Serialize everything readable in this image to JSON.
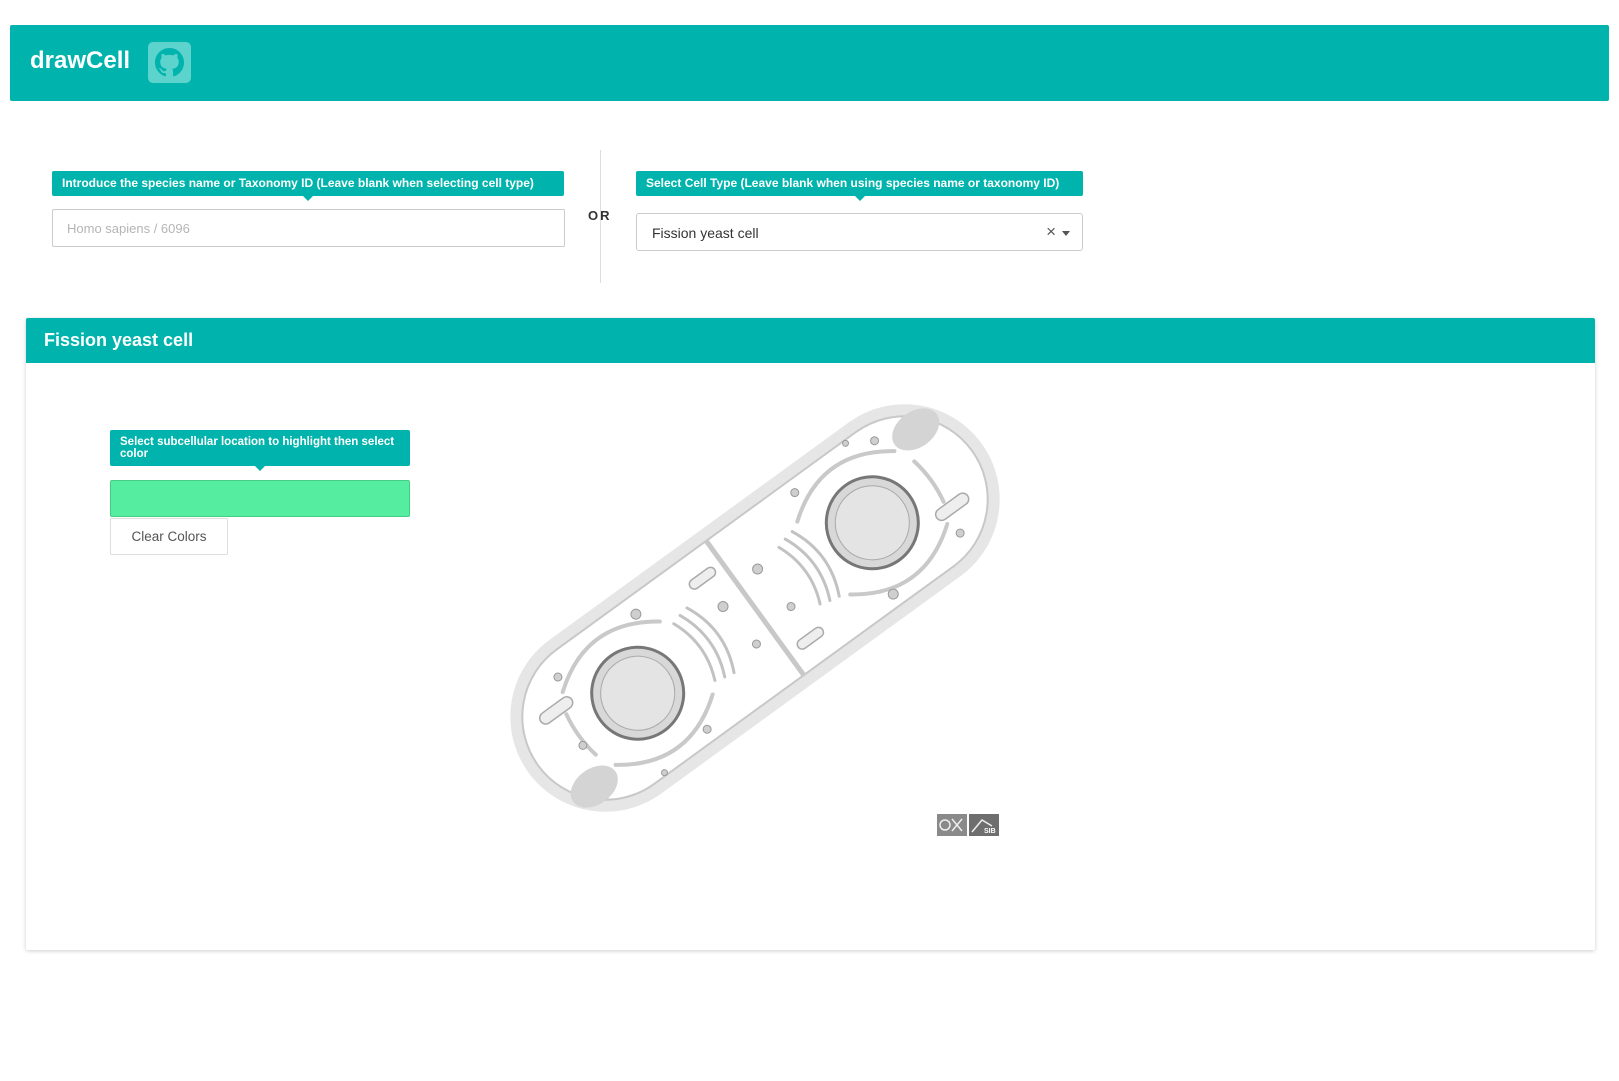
{
  "navbar": {
    "title": "drawCell",
    "github_icon": "github-icon"
  },
  "species": {
    "tooltip": "Introduce the species name or Taxonomy ID (Leave blank when selecting cell type)",
    "placeholder": "Homo sapiens / 6096",
    "value": ""
  },
  "separator": {
    "label": "OR"
  },
  "celltype": {
    "tooltip": "Select Cell Type (Leave blank when using species name or taxonomy ID)",
    "selected": "Fission yeast cell",
    "clear_glyph": "×"
  },
  "panel": {
    "title": "Fission yeast cell",
    "location_tooltip": "Select subcellular location to highlight then select color",
    "selected_color": "#55eea0",
    "clear_button": "Clear Colors"
  },
  "colors": {
    "accent": "#00b4ad",
    "swatch": "#55eea0"
  },
  "logos": [
    "expasy-logo",
    "sib-logo"
  ]
}
